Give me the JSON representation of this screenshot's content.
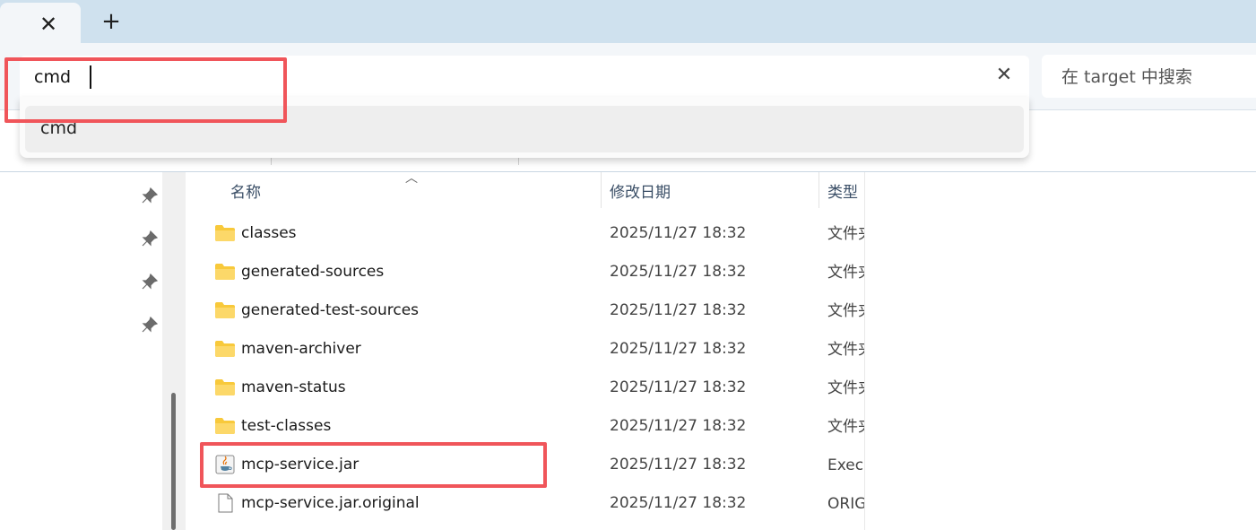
{
  "tabbar": {
    "close_glyph": "✕",
    "new_tab_glyph": "+"
  },
  "address": {
    "value": "cmd",
    "clear_glyph": "✕",
    "suggestions": [
      {
        "label": "cmd"
      }
    ]
  },
  "search": {
    "placeholder": "在 target 中搜索"
  },
  "columns": {
    "name": "名称",
    "date": "修改日期",
    "type": "类型"
  },
  "files": [
    {
      "name": "classes",
      "date": "2025/11/27 18:32",
      "type": "文件夹",
      "icon": "folder-icon"
    },
    {
      "name": "generated-sources",
      "date": "2025/11/27 18:32",
      "type": "文件夹",
      "icon": "folder-icon"
    },
    {
      "name": "generated-test-sources",
      "date": "2025/11/27 18:32",
      "type": "文件夹",
      "icon": "folder-icon"
    },
    {
      "name": "maven-archiver",
      "date": "2025/11/27 18:32",
      "type": "文件夹",
      "icon": "folder-icon"
    },
    {
      "name": "maven-status",
      "date": "2025/11/27 18:32",
      "type": "文件夹",
      "icon": "folder-icon"
    },
    {
      "name": "test-classes",
      "date": "2025/11/27 18:32",
      "type": "文件夹",
      "icon": "folder-icon"
    },
    {
      "name": "mcp-service.jar",
      "date": "2025/11/27 18:32",
      "type": "Executable Jar File",
      "icon": "java-jar-icon"
    },
    {
      "name": "mcp-service.jar.original",
      "date": "2025/11/27 18:32",
      "type": "ORIGINAL 文件",
      "icon": "file-icon"
    }
  ],
  "colors": {
    "accent": "#0067c0",
    "annotation": "#f0555a",
    "folder": "#f8c93b",
    "tabbar": "#cfe1ee"
  }
}
